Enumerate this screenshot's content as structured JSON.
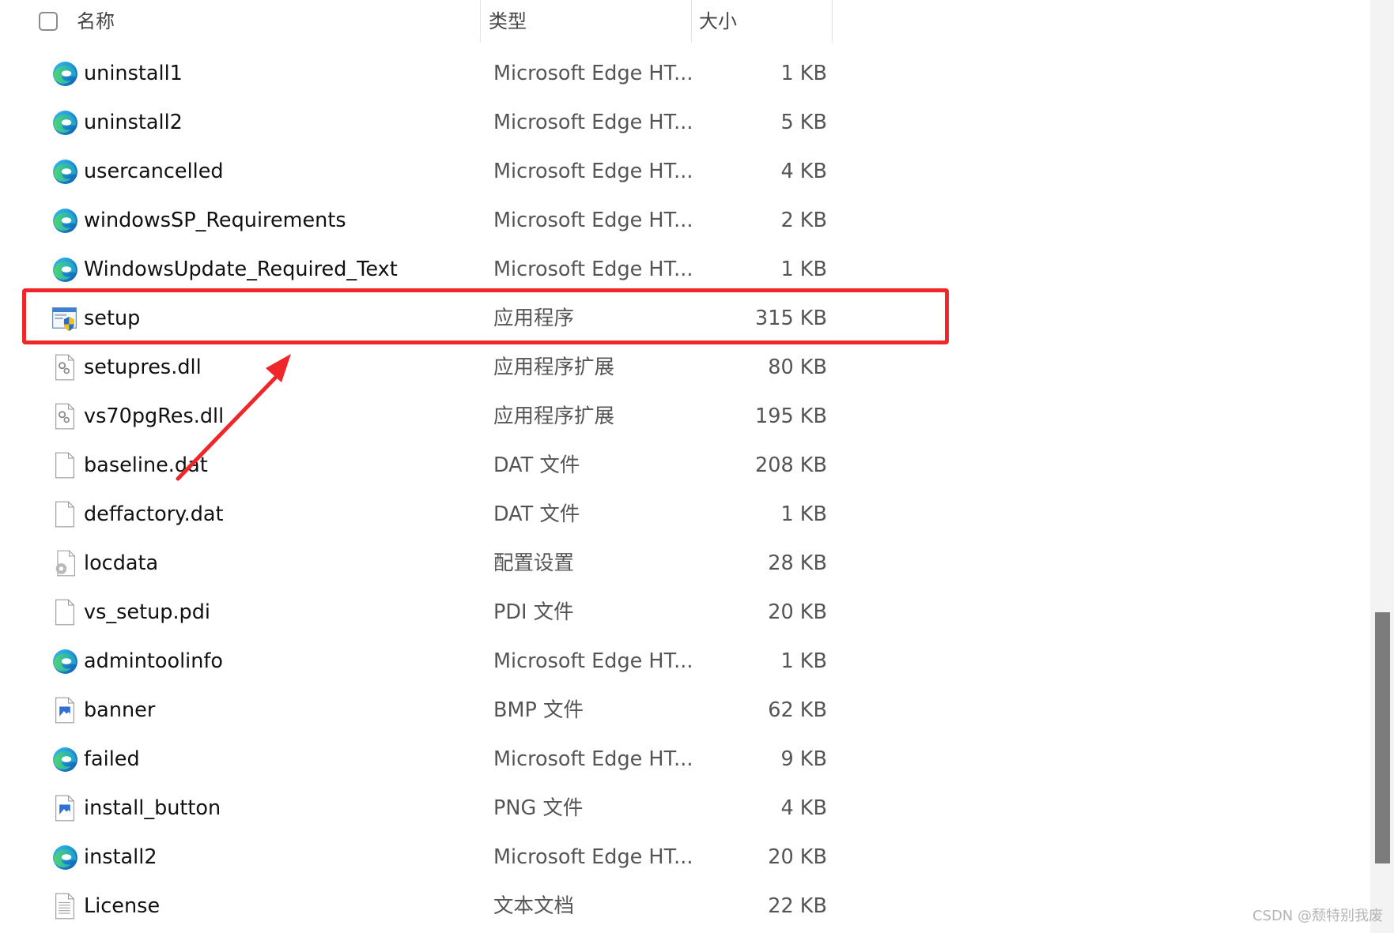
{
  "header": {
    "name_label": "名称",
    "type_label": "类型",
    "size_label": "大小"
  },
  "files": [
    {
      "name": "uninstall1",
      "type": "Microsoft Edge HT...",
      "size": "1 KB",
      "icon": "edge-icon"
    },
    {
      "name": "uninstall2",
      "type": "Microsoft Edge HT...",
      "size": "5 KB",
      "icon": "edge-icon"
    },
    {
      "name": "usercancelled",
      "type": "Microsoft Edge HT...",
      "size": "4 KB",
      "icon": "edge-icon"
    },
    {
      "name": "windowsSP_Requirements",
      "type": "Microsoft Edge HT...",
      "size": "2 KB",
      "icon": "edge-icon"
    },
    {
      "name": "WindowsUpdate_Required_Text",
      "type": "Microsoft Edge HT...",
      "size": "1 KB",
      "icon": "edge-icon"
    },
    {
      "name": "setup",
      "type": "应用程序",
      "size": "315 KB",
      "icon": "setup-exe-icon"
    },
    {
      "name": "setupres.dll",
      "type": "应用程序扩展",
      "size": "80 KB",
      "icon": "dll-file-icon"
    },
    {
      "name": "vs70pgRes.dll",
      "type": "应用程序扩展",
      "size": "195 KB",
      "icon": "dll-file-icon"
    },
    {
      "name": "baseline.dat",
      "type": "DAT 文件",
      "size": "208 KB",
      "icon": "blank-file-icon"
    },
    {
      "name": "deffactory.dat",
      "type": "DAT 文件",
      "size": "1 KB",
      "icon": "blank-file-icon"
    },
    {
      "name": "locdata",
      "type": "配置设置",
      "size": "28 KB",
      "icon": "config-file-icon"
    },
    {
      "name": "vs_setup.pdi",
      "type": "PDI 文件",
      "size": "20 KB",
      "icon": "blank-file-icon"
    },
    {
      "name": "admintoolinfo",
      "type": "Microsoft Edge HT...",
      "size": "1 KB",
      "icon": "edge-icon"
    },
    {
      "name": "banner",
      "type": "BMP 文件",
      "size": "62 KB",
      "icon": "image-file-icon"
    },
    {
      "name": "failed",
      "type": "Microsoft Edge HT...",
      "size": "9 KB",
      "icon": "edge-icon"
    },
    {
      "name": "install_button",
      "type": "PNG 文件",
      "size": "4 KB",
      "icon": "image-file-icon"
    },
    {
      "name": "install2",
      "type": "Microsoft Edge HT...",
      "size": "20 KB",
      "icon": "edge-icon"
    },
    {
      "name": "License",
      "type": "文本文档",
      "size": "22 KB",
      "icon": "text-file-icon"
    }
  ],
  "highlighted_file": "setup",
  "annotation_color": "#f0272a",
  "watermark": "CSDN @颓特别我废"
}
